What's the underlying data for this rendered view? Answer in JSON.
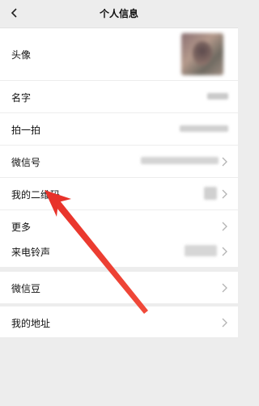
{
  "header": {
    "title": "个人信息",
    "back_icon": "chevron-left-icon"
  },
  "rows": [
    {
      "label": "头像"
    },
    {
      "label": "名字"
    },
    {
      "label": "拍一拍"
    },
    {
      "label": "微信号"
    },
    {
      "label": "我的二维码"
    },
    {
      "label": "更多"
    },
    {
      "label": "来电铃声"
    },
    {
      "label": "微信豆"
    },
    {
      "label": "我的地址"
    }
  ],
  "annotation": {
    "arrow_color": "#e8322a"
  }
}
